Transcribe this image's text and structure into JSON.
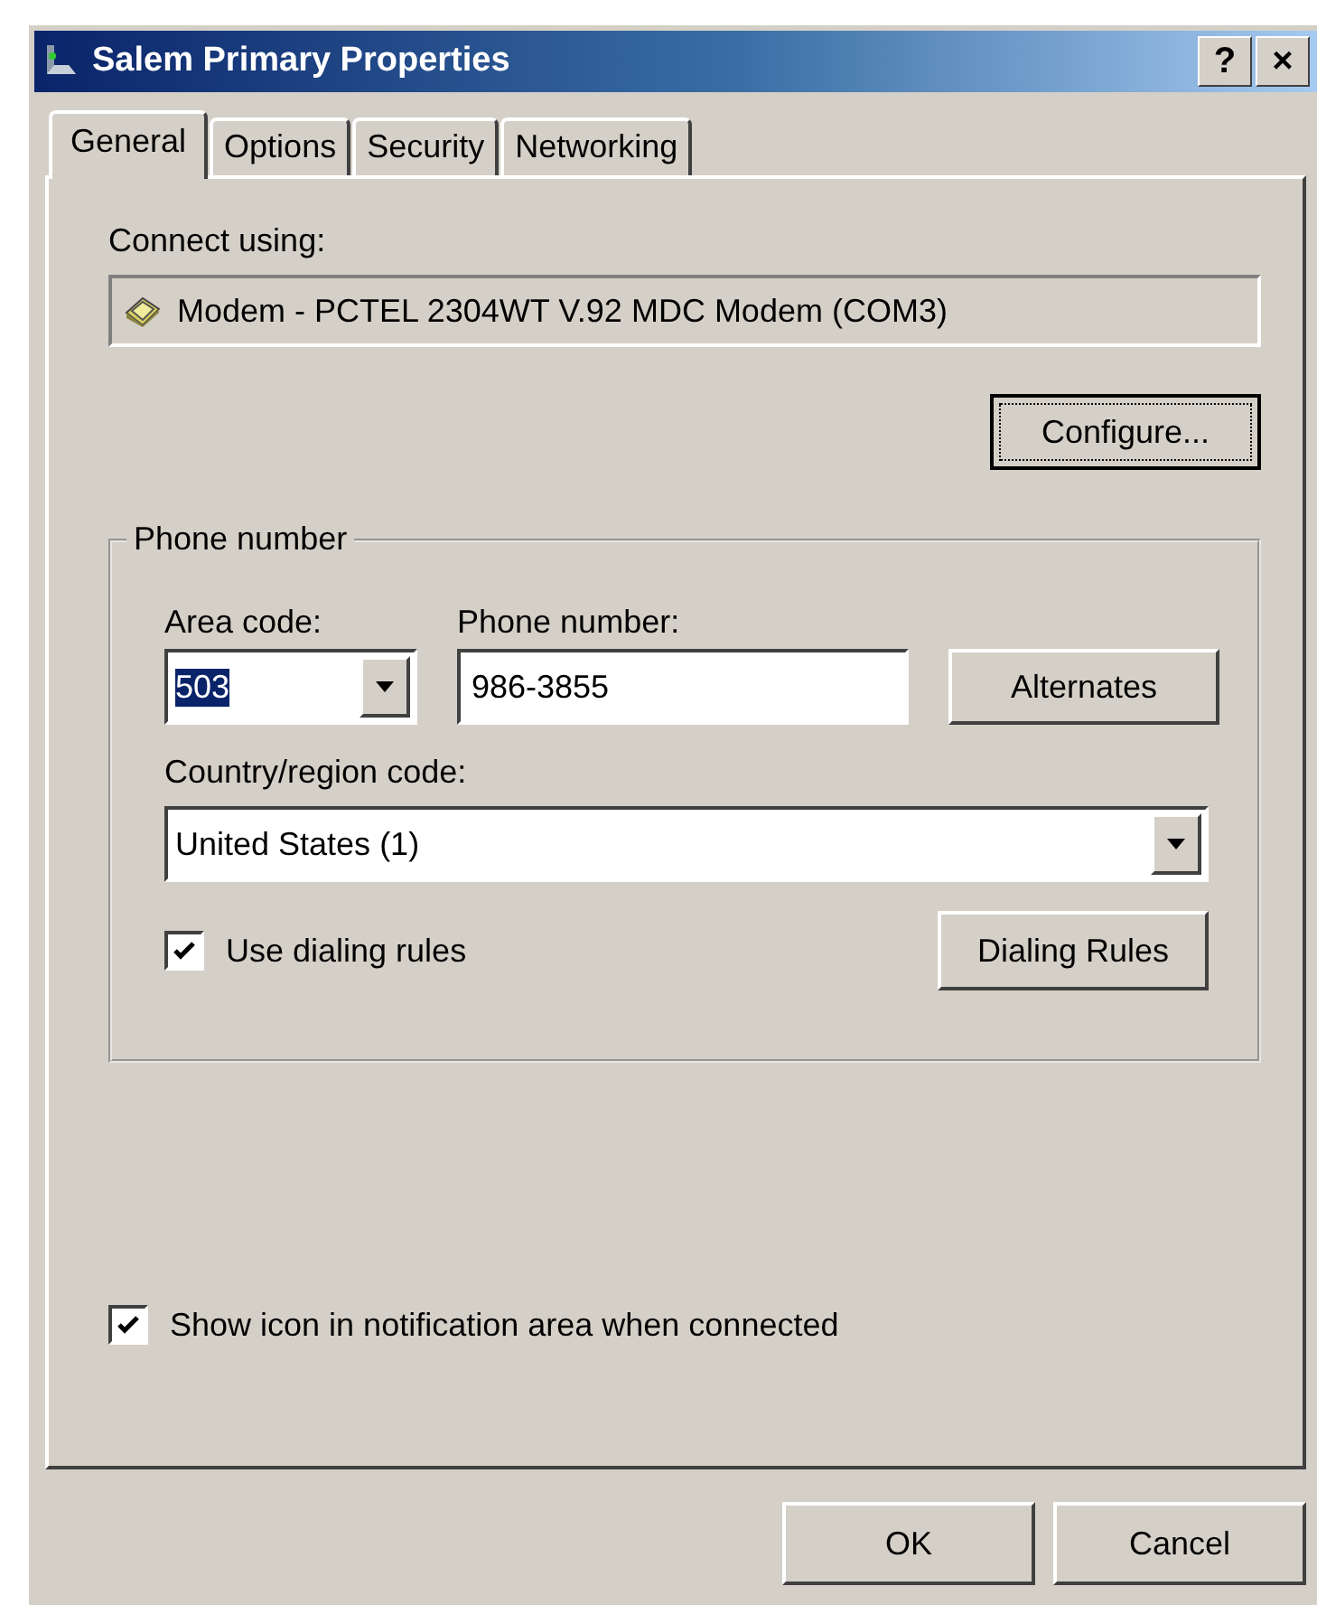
{
  "window": {
    "title": "Salem Primary Properties",
    "help_button": "?",
    "close_button": "×"
  },
  "tabs": [
    {
      "label": "General",
      "selected": true
    },
    {
      "label": "Options",
      "selected": false
    },
    {
      "label": "Security",
      "selected": false
    },
    {
      "label": "Networking",
      "selected": false
    }
  ],
  "connect_using": {
    "label": "Connect using:",
    "device": "Modem - PCTEL 2304WT V.92 MDC Modem (COM3)"
  },
  "configure_button": {
    "label": "Configure...",
    "focused": true
  },
  "phone_group": {
    "title": "Phone number",
    "area_code": {
      "label": "Area code:",
      "value": "503",
      "selected_text": true
    },
    "phone_number": {
      "label": "Phone number:",
      "value": "986-3855"
    },
    "alternates_button": "Alternates",
    "country": {
      "label": "Country/region code:",
      "value": "United States (1)"
    },
    "use_dialing_rules": {
      "label": "Use dialing rules",
      "checked": true
    },
    "dialing_rules_button": "Dialing Rules"
  },
  "show_icon": {
    "label": "Show icon in notification area when connected",
    "checked": true
  },
  "buttons": [
    "OK",
    "Cancel"
  ]
}
